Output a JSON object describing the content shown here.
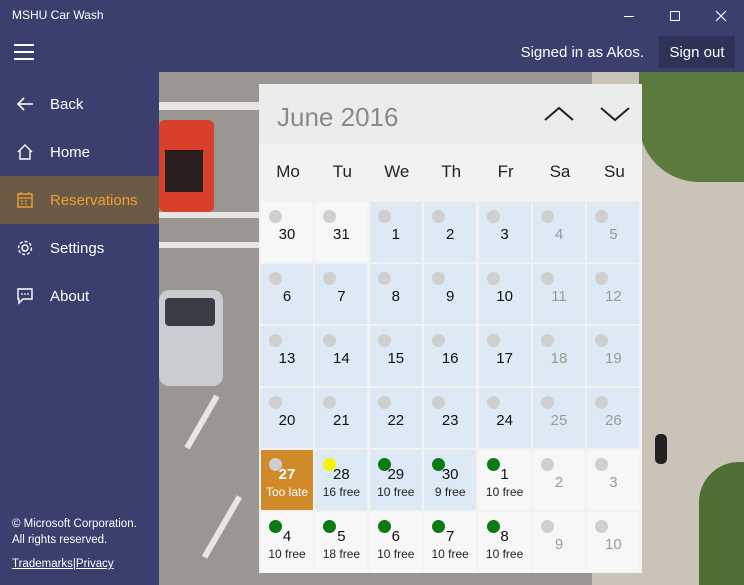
{
  "window": {
    "title": "MSHU Car Wash"
  },
  "header": {
    "signed_in": "Signed in as Akos.",
    "sign_out": "Sign out"
  },
  "sidebar": {
    "items": [
      {
        "label": "Back",
        "icon": "back-arrow-icon"
      },
      {
        "label": "Home",
        "icon": "home-icon"
      },
      {
        "label": "Reservations",
        "icon": "calendar-icon",
        "active": true
      },
      {
        "label": "Settings",
        "icon": "gear-icon"
      },
      {
        "label": "About",
        "icon": "chat-bubble-icon"
      }
    ],
    "footer_line1": "© Microsoft Corporation.",
    "footer_line2": "All rights reserved.",
    "trademarks": "Trademarks",
    "separator": "|",
    "privacy": "Privacy"
  },
  "calendar": {
    "month_title": "June 2016",
    "weekdays": [
      "Mo",
      "Tu",
      "We",
      "Th",
      "Fr",
      "Sa",
      "Su"
    ],
    "weeks": [
      [
        {
          "day": "30",
          "bg": "white",
          "dot": "grey"
        },
        {
          "day": "31",
          "bg": "white",
          "dot": "grey"
        },
        {
          "day": "1",
          "bg": "blue",
          "dot": "grey"
        },
        {
          "day": "2",
          "bg": "blue",
          "dot": "grey"
        },
        {
          "day": "3",
          "bg": "blue",
          "dot": "grey"
        },
        {
          "day": "4",
          "bg": "blue",
          "dot": "grey",
          "muted": true
        },
        {
          "day": "5",
          "bg": "blue",
          "dot": "grey",
          "muted": true
        }
      ],
      [
        {
          "day": "6",
          "bg": "blue",
          "dot": "grey"
        },
        {
          "day": "7",
          "bg": "blue",
          "dot": "grey"
        },
        {
          "day": "8",
          "bg": "blue",
          "dot": "grey"
        },
        {
          "day": "9",
          "bg": "blue",
          "dot": "grey"
        },
        {
          "day": "10",
          "bg": "blue",
          "dot": "grey"
        },
        {
          "day": "11",
          "bg": "blue",
          "dot": "grey",
          "muted": true
        },
        {
          "day": "12",
          "bg": "blue",
          "dot": "grey",
          "muted": true
        }
      ],
      [
        {
          "day": "13",
          "bg": "blue",
          "dot": "grey"
        },
        {
          "day": "14",
          "bg": "blue",
          "dot": "grey"
        },
        {
          "day": "15",
          "bg": "blue",
          "dot": "grey"
        },
        {
          "day": "16",
          "bg": "blue",
          "dot": "grey"
        },
        {
          "day": "17",
          "bg": "blue",
          "dot": "grey"
        },
        {
          "day": "18",
          "bg": "blue",
          "dot": "grey",
          "muted": true
        },
        {
          "day": "19",
          "bg": "blue",
          "dot": "grey",
          "muted": true
        }
      ],
      [
        {
          "day": "20",
          "bg": "blue",
          "dot": "grey"
        },
        {
          "day": "21",
          "bg": "blue",
          "dot": "grey"
        },
        {
          "day": "22",
          "bg": "blue",
          "dot": "grey"
        },
        {
          "day": "23",
          "bg": "blue",
          "dot": "grey"
        },
        {
          "day": "24",
          "bg": "blue",
          "dot": "grey"
        },
        {
          "day": "25",
          "bg": "blue",
          "dot": "grey",
          "muted": true
        },
        {
          "day": "26",
          "bg": "blue",
          "dot": "grey",
          "muted": true
        }
      ],
      [
        {
          "day": "27",
          "bg": "selected",
          "dot": "grey",
          "sub": "Too late"
        },
        {
          "day": "28",
          "bg": "blue",
          "dot": "yellow",
          "sub": "16 free"
        },
        {
          "day": "29",
          "bg": "blue",
          "dot": "green",
          "sub": "10 free"
        },
        {
          "day": "30",
          "bg": "blue",
          "dot": "green",
          "sub": "9 free"
        },
        {
          "day": "1",
          "bg": "white",
          "dot": "green",
          "sub": "10 free"
        },
        {
          "day": "2",
          "bg": "white",
          "dot": "grey",
          "muted": true
        },
        {
          "day": "3",
          "bg": "white",
          "dot": "grey",
          "muted": true
        }
      ],
      [
        {
          "day": "4",
          "bg": "white",
          "dot": "green",
          "sub": "10 free"
        },
        {
          "day": "5",
          "bg": "white",
          "dot": "green",
          "sub": "18 free"
        },
        {
          "day": "6",
          "bg": "white",
          "dot": "green",
          "sub": "10 free"
        },
        {
          "day": "7",
          "bg": "white",
          "dot": "green",
          "sub": "10 free"
        },
        {
          "day": "8",
          "bg": "white",
          "dot": "green",
          "sub": "10 free"
        },
        {
          "day": "9",
          "bg": "white",
          "dot": "grey",
          "muted": true
        },
        {
          "day": "10",
          "bg": "white",
          "dot": "grey",
          "muted": true
        }
      ]
    ]
  },
  "colors": {
    "chrome": "#3b3f6e",
    "accent": "#f0a030",
    "selected_day": "#d08a2a"
  }
}
